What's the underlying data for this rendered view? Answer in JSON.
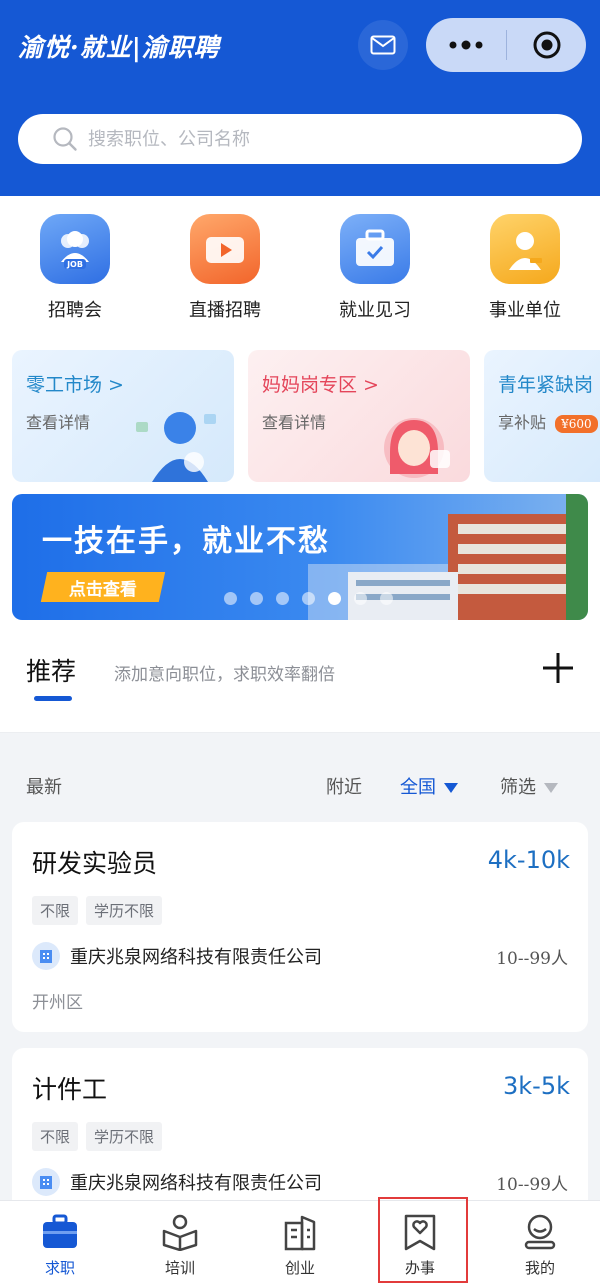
{
  "header": {
    "brand": "渝悦·就业|渝职聘",
    "search_placeholder": "搜索职位、公司名称"
  },
  "quick_links": [
    {
      "label": "招聘会",
      "icon": "job-fair-icon",
      "color": "#3f86f0"
    },
    {
      "label": "直播招聘",
      "icon": "live-video-icon",
      "color": "#f47a35"
    },
    {
      "label": "就业见习",
      "icon": "briefcase-icon",
      "color": "#4a8df2"
    },
    {
      "label": "事业单位",
      "icon": "person-badge-icon",
      "color": "#f7b02a"
    }
  ],
  "zones": [
    {
      "title": "零工市场 >",
      "sub": "查看详情",
      "color": "#2388c9"
    },
    {
      "title": "妈妈岗专区 >",
      "sub": "查看详情",
      "color": "#e4455a"
    },
    {
      "title": "青年紧缺岗",
      "sub": "享补贴",
      "badge": "¥600",
      "color": "#2388c9"
    }
  ],
  "banner": {
    "title": "一技在手，就业不愁",
    "button": "点击查看",
    "dots_total": 7,
    "dots_active": 5
  },
  "recommend": {
    "title": "推荐",
    "hint": "添加意向职位，求职效率翻倍"
  },
  "filters": {
    "latest": "最新",
    "nearby": "附近",
    "region": "全国",
    "sort": "筛选"
  },
  "jobs": [
    {
      "title": "研发实验员",
      "salary": "4k-10k",
      "tags": [
        "不限",
        "学历不限"
      ],
      "company": "重庆兆泉网络科技有限责任公司",
      "size": "10--99人",
      "area": "开州区"
    },
    {
      "title": "计件工",
      "salary": "3k-5k",
      "tags": [
        "不限",
        "学历不限"
      ],
      "company": "重庆兆泉网络科技有限责任公司",
      "size": "10--99人",
      "area": ""
    }
  ],
  "tabs": [
    {
      "label": "求职",
      "icon": "briefcase-tab-icon",
      "active": true
    },
    {
      "label": "培训",
      "icon": "book-tab-icon",
      "active": false
    },
    {
      "label": "创业",
      "icon": "building-tab-icon",
      "active": false
    },
    {
      "label": "办事",
      "icon": "heart-bookmark-tab-icon",
      "active": false
    },
    {
      "label": "我的",
      "icon": "profile-tab-icon",
      "active": false
    }
  ],
  "colors": {
    "primary": "#1558d4",
    "salary": "#1d6fc2",
    "highlight_box": "#e23b3b"
  }
}
